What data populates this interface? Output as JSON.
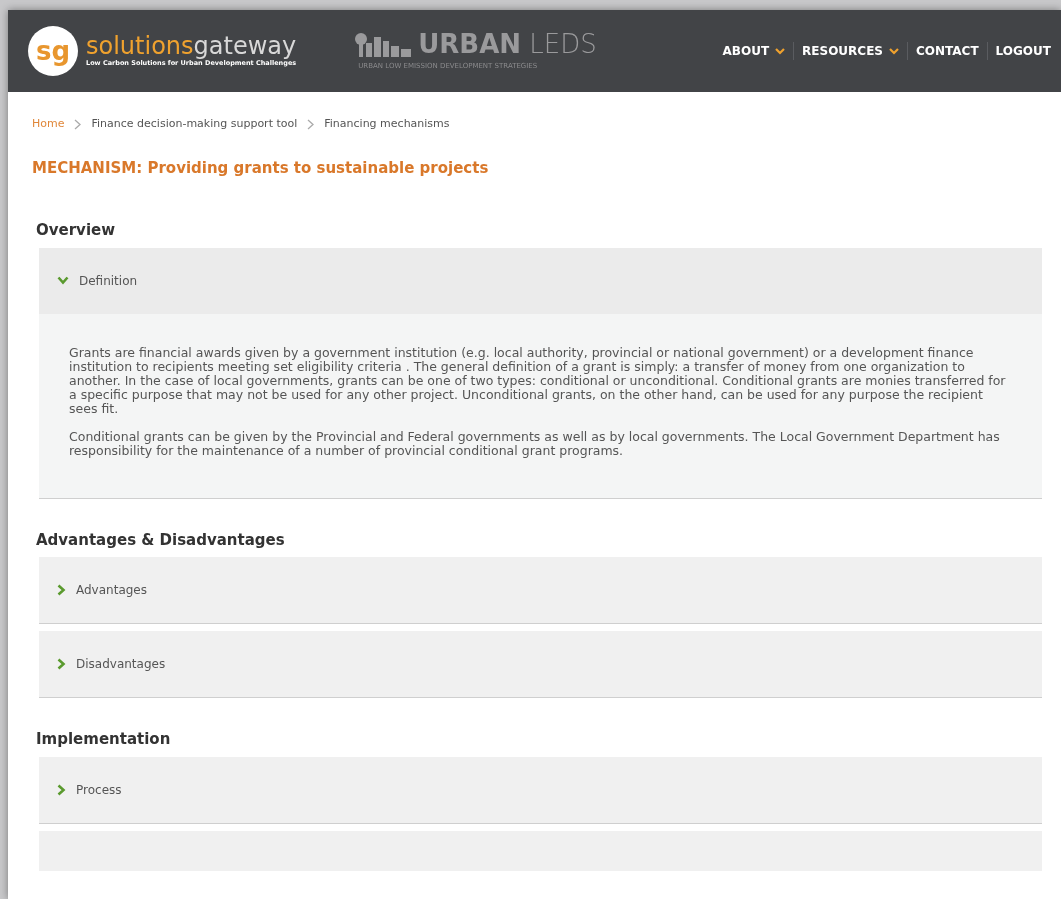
{
  "header": {
    "logo_mark": "sg",
    "brand_first": "solutions",
    "brand_second": "gateway",
    "tagline": "Low Carbon Solutions for Urban Development Challenges",
    "partner_name_bold": "URBAN",
    "partner_name_light": "LEDS",
    "partner_tagline": "URBAN LOW EMISSION DEVELOPMENT STRATEGIES",
    "nav": [
      {
        "label": "ABOUT",
        "dropdown": true
      },
      {
        "label": "RESOURCES",
        "dropdown": true
      },
      {
        "label": "CONTACT",
        "dropdown": false
      },
      {
        "label": "LOGOUT",
        "dropdown": false
      }
    ]
  },
  "breadcrumb": [
    {
      "label": "Home",
      "link": true
    },
    {
      "label": "Finance decision-making support tool",
      "link": false
    },
    {
      "label": "Financing mechanisms",
      "link": false
    }
  ],
  "page_title": "MECHANISM: Providing grants to sustainable projects",
  "sections": [
    {
      "heading": "Overview",
      "panels": [
        {
          "title": "Definition",
          "expanded": true,
          "paragraphs": [
            "Grants are financial awards given by a government institution (e.g. local authority, provincial or national government) or a development finance institution to recipients meeting set eligibility criteria . The general definition of a grant is simply: a transfer of money from one organization to another. In the case of local governments, grants can be one of two types: conditional or unconditional. Conditional grants are monies transferred for a specific purpose that may not be used for any other project. Unconditional grants, on the other hand, can be used for any purpose the recipient sees fit.",
            "Conditional grants can be given by the Provincial and Federal governments as well as by local governments. The Local Government Department has responsibility for the maintenance of a number of provincial conditional grant programs."
          ]
        }
      ]
    },
    {
      "heading": "Advantages & Disadvantages",
      "panels": [
        {
          "title": "Advantages",
          "expanded": false
        },
        {
          "title": "Disadvantages",
          "expanded": false
        }
      ]
    },
    {
      "heading": "Implementation",
      "panels": [
        {
          "title": "Process",
          "expanded": false
        }
      ]
    }
  ]
}
